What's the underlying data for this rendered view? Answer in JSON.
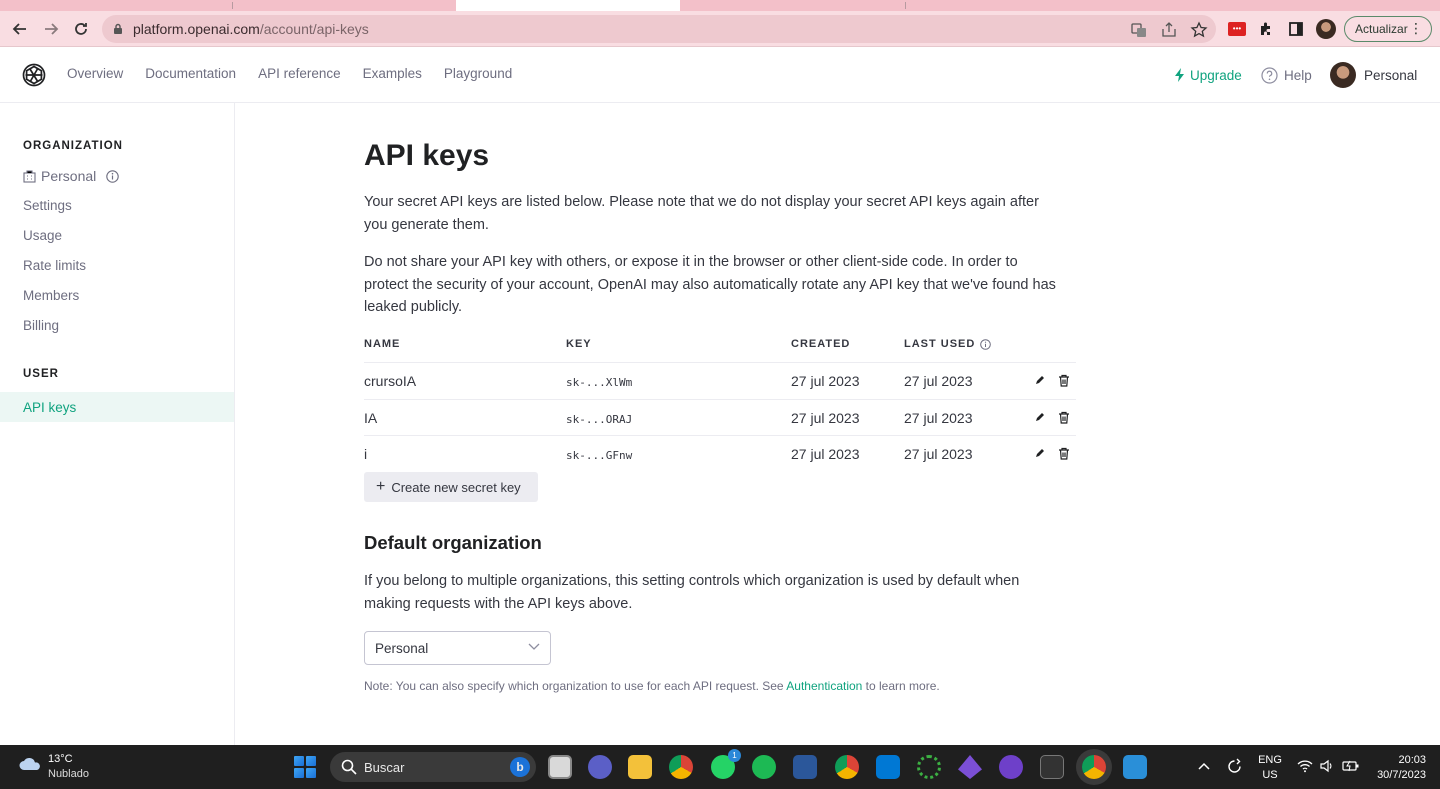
{
  "browser": {
    "url_host": "platform.openai.com",
    "url_path": "/account/api-keys",
    "update_button": "Actualizar"
  },
  "header": {
    "nav": [
      "Overview",
      "Documentation",
      "API reference",
      "Examples",
      "Playground"
    ],
    "upgrade": "Upgrade",
    "help": "Help",
    "account": "Personal"
  },
  "sidebar": {
    "org_heading": "ORGANIZATION",
    "org_name": "Personal",
    "org_items": [
      "Settings",
      "Usage",
      "Rate limits",
      "Members",
      "Billing"
    ],
    "user_heading": "USER",
    "active_item": "API keys"
  },
  "main": {
    "title": "API keys",
    "intro": "Your secret API keys are listed below. Please note that we do not display your secret API keys again after you generate them.",
    "warning": "Do not share your API key with others, or expose it in the browser or other client-side code. In order to protect the security of your account, OpenAI may also automatically rotate any API key that we've found has leaked publicly.",
    "table": {
      "headers": [
        "NAME",
        "KEY",
        "CREATED",
        "LAST USED"
      ],
      "rows": [
        {
          "name": "crursoIA",
          "key": "sk-...XlWm",
          "created": "27 jul 2023",
          "last_used": "27 jul 2023"
        },
        {
          "name": "IA",
          "key": "sk-...ORAJ",
          "created": "27 jul 2023",
          "last_used": "27 jul 2023"
        },
        {
          "name": "i",
          "key": "sk-...GFnw",
          "created": "27 jul 2023",
          "last_used": "27 jul 2023"
        }
      ]
    },
    "create_button": "Create new secret key",
    "default_org_title": "Default organization",
    "default_org_text": "If you belong to multiple organizations, this setting controls which organization is used by default when making requests with the API keys above.",
    "default_org_value": "Personal",
    "note_prefix": "Note: You can also specify which organization to use for each API request. See ",
    "note_link": "Authentication",
    "note_suffix": " to learn more."
  },
  "taskbar": {
    "temperature": "13°C",
    "weather": "Nublado",
    "search_placeholder": "Buscar",
    "whatsapp_badge": "1",
    "lang_top": "ENG",
    "lang_bottom": "US",
    "time": "20:03",
    "date": "30/7/2023"
  },
  "colors": {
    "accent": "#10a37f",
    "sidebar_active_bg": "#ecf7f4",
    "chrome_toolbar": "#f9dde2",
    "taskbar": "#1f1f1f"
  }
}
